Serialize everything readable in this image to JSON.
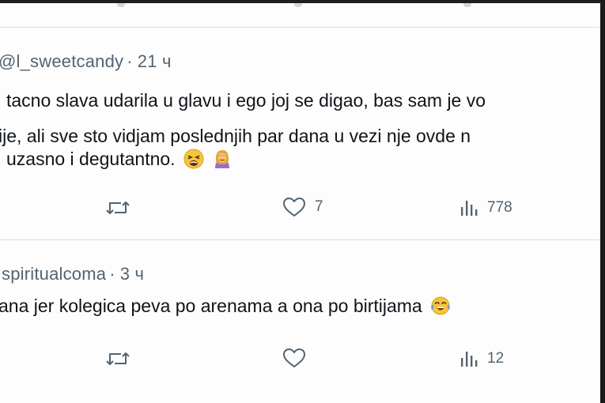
{
  "tweets": [
    {
      "handle": "@l_sweetcandy",
      "separator": "·",
      "time": "21 ч",
      "lines": [
        "tacno slava udarila u glavu i ego joj se digao, bas sam je vo",
        "ije, ali sve sto vidjam poslednjih par dana u vezi nje ovde n",
        "uzasno i degutantno."
      ],
      "emojis": [
        "weary-face-emoji",
        "facepalm-woman-emoji"
      ],
      "likes": "7",
      "views": "778"
    },
    {
      "handle": "spiritualcoma",
      "separator": "·",
      "time": "3 ч",
      "lines": [
        "ana jer kolegica peva po arenama a ona po birtijama"
      ],
      "emojis": [
        "tears-of-joy-emoji"
      ],
      "likes": "",
      "views": "12"
    }
  ],
  "icons": {
    "retweet": "retweet-icon",
    "like": "heart-icon",
    "views": "views-chart-icon"
  },
  "colors": {
    "text": "#0f1419",
    "muted": "#536471",
    "divider": "#d9dde1"
  }
}
